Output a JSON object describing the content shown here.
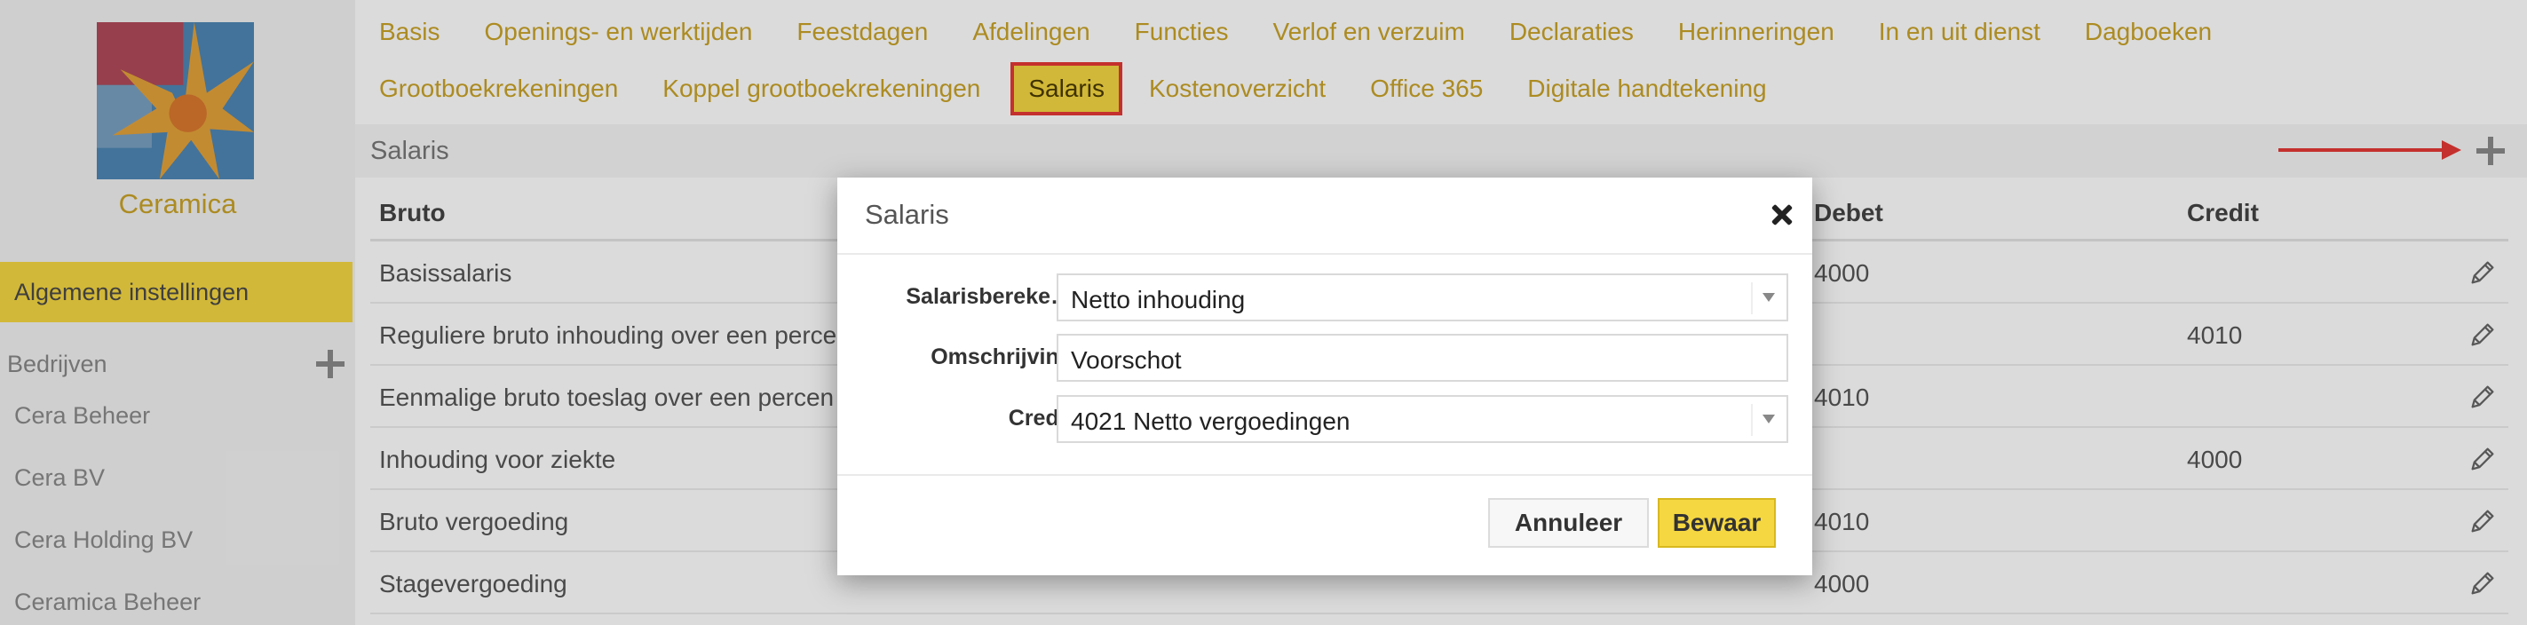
{
  "sidebar": {
    "company_name": "Ceramica",
    "active_item": "Algemene instellingen",
    "section_label": "Bedrijven",
    "companies": [
      "Cera Beheer",
      "Cera BV",
      "Cera Holding BV",
      "Ceramica Beheer"
    ]
  },
  "tabs": {
    "row1": [
      "Basis",
      "Openings- en werktijden",
      "Feestdagen",
      "Afdelingen",
      "Functies",
      "Verlof en verzuim",
      "Declaraties",
      "Herinneringen",
      "In en uit dienst",
      "Dagboeken"
    ],
    "row2_before": [
      "Grootboekrekeningen",
      "Koppel grootboekrekeningen"
    ],
    "active": "Salaris",
    "row2_after": [
      "Kostenoverzicht",
      "Office 365",
      "Digitale handtekening"
    ]
  },
  "page": {
    "title": "Salaris"
  },
  "table": {
    "headers": {
      "bruto": "Bruto",
      "debet": "Debet",
      "credit": "Credit"
    },
    "rows": [
      {
        "name": "Basissalaris",
        "debet": "4000",
        "credit": ""
      },
      {
        "name": "Reguliere bruto inhouding over een perce",
        "debet": "",
        "credit": "4010"
      },
      {
        "name": "Eenmalige bruto toeslag over een percen",
        "debet": "4010",
        "credit": ""
      },
      {
        "name": "Inhouding voor ziekte",
        "debet": "",
        "credit": "4000"
      },
      {
        "name": "Bruto vergoeding",
        "debet": "4010",
        "credit": ""
      },
      {
        "name": "Stagevergoeding",
        "debet": "4000",
        "credit": ""
      }
    ]
  },
  "modal": {
    "title": "Salaris",
    "fields": {
      "salarisberekening": {
        "label": "Salarisbereke…",
        "value": "Netto inhouding"
      },
      "omschrijving": {
        "label": "Omschrijving",
        "value": "Voorschot"
      },
      "credit": {
        "label": "Credit",
        "value": "4021 Netto vergoedingen"
      }
    },
    "cancel_label": "Annuleer",
    "save_label": "Bewaar"
  },
  "colors": {
    "accent": "#f5d742",
    "tab_text": "#c9a227",
    "highlight": "#e53935"
  }
}
